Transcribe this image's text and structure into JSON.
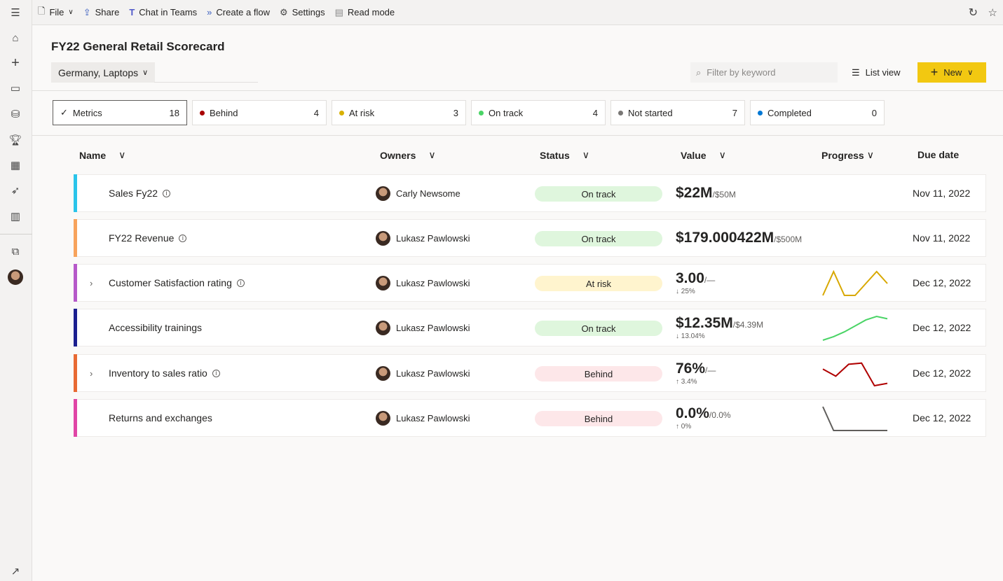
{
  "toolbar": {
    "file": "File",
    "share": "Share",
    "chat": "Chat in Teams",
    "flow": "Create a flow",
    "settings": "Settings",
    "read_mode": "Read mode"
  },
  "page": {
    "title": "FY22 General Retail Scorecard",
    "filter": "Germany, Laptops",
    "search_placeholder": "Filter by keyword",
    "list_view": "List view",
    "new": "New"
  },
  "summary": [
    {
      "label": "Metrics",
      "count": "18",
      "color": ""
    },
    {
      "label": "Behind",
      "count": "4",
      "color": "#a80000"
    },
    {
      "label": "At risk",
      "count": "3",
      "color": "#d8b000"
    },
    {
      "label": "On track",
      "count": "4",
      "color": "#4ad466"
    },
    {
      "label": "Not started",
      "count": "7",
      "color": "#797775"
    },
    {
      "label": "Completed",
      "count": "0",
      "color": "#0078d4"
    }
  ],
  "columns": {
    "name": "Name",
    "owners": "Owners",
    "status": "Status",
    "value": "Value",
    "progress": "Progress",
    "due": "Due date"
  },
  "status_colors": {
    "On track": "#dff6dd",
    "At risk": "#fff4ce",
    "Behind": "#fde7e9"
  },
  "metrics": [
    {
      "name": "Sales Fy22",
      "info": true,
      "expandable": false,
      "color": "#2ac4ea",
      "owner": "Carly Newsome",
      "status": "On track",
      "value": "$22M",
      "target": "/$50M",
      "change": "",
      "trend": [],
      "trend_color": "",
      "due": "Nov 11, 2022"
    },
    {
      "name": "FY22 Revenue",
      "info": true,
      "expandable": false,
      "color": "#f7a35c",
      "owner": "Lukasz Pawlowski",
      "status": "On track",
      "value": "$179.000422M",
      "target": "/$500M",
      "change": "",
      "trend": [],
      "trend_color": "",
      "due": "Nov 11, 2022"
    },
    {
      "name": "Customer Satisfaction rating",
      "info": true,
      "expandable": true,
      "color": "#b659c9",
      "owner": "Lukasz Pawlowski",
      "status": "At risk",
      "value": "3.00",
      "target": "/—",
      "change": "↓ 25%",
      "trend": [
        0,
        1,
        0,
        0,
        0.5,
        1,
        0.5
      ],
      "trend_color": "#d8a800",
      "due": "Dec 12, 2022"
    },
    {
      "name": "Accessibility trainings",
      "info": false,
      "expandable": false,
      "color": "#1b1f8f",
      "owner": "Lukasz Pawlowski",
      "status": "On track",
      "value": "$12.35M",
      "target": "/$4.39M",
      "change": "↓ 13.04%",
      "trend": [
        0,
        0.15,
        0.35,
        0.6,
        0.85,
        1,
        0.9
      ],
      "trend_color": "#4ad466",
      "due": "Dec 12, 2022"
    },
    {
      "name": "Inventory to sales ratio",
      "info": true,
      "expandable": true,
      "color": "#e86a33",
      "owner": "Lukasz Pawlowski",
      "status": "Behind",
      "value": "76%",
      "target": "/—",
      "change": "↑ 3.4%",
      "trend": [
        0.7,
        0.4,
        0.9,
        0.95,
        0,
        0.1
      ],
      "trend_color": "#b00000",
      "due": "Dec 12, 2022"
    },
    {
      "name": "Returns and exchanges",
      "info": false,
      "expandable": false,
      "color": "#e045a6",
      "owner": "Lukasz Pawlowski",
      "status": "Behind",
      "value": "0.0%",
      "target": "/0.0%",
      "change": "↑ 0%",
      "trend": [
        1,
        0,
        0,
        0,
        0,
        0,
        0
      ],
      "trend_color": "#605e5c",
      "due": "Dec 12, 2022"
    }
  ]
}
